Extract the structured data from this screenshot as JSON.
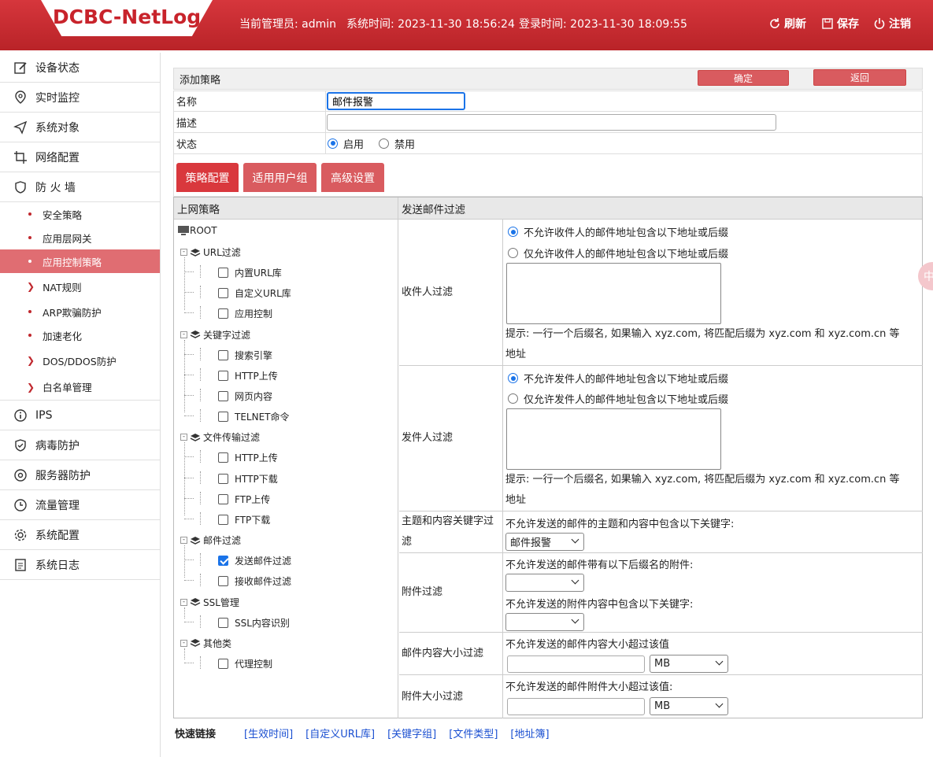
{
  "header": {
    "logo": "DCBC-NetLog",
    "admin": "当前管理员: admin",
    "system_time": "系统时间: 2023-11-30 18:56:24",
    "login_time": "登录时间: 2023-11-30 18:09:55",
    "refresh": "刷新",
    "save": "保存",
    "logout": "注销"
  },
  "sidebar": {
    "items": [
      {
        "label": "设备状态",
        "icon": "edit-icon"
      },
      {
        "label": "实时监控",
        "icon": "location-icon"
      },
      {
        "label": "系统对象",
        "icon": "send-icon"
      },
      {
        "label": "网络配置",
        "icon": "crop-icon"
      },
      {
        "label": "防 火 墙",
        "icon": "shield-icon"
      }
    ],
    "firewall_sub": [
      "安全策略",
      "应用层网关",
      "应用控制策略",
      "NAT规则",
      "ARP欺骗防护",
      "加速老化",
      "DOS/DDOS防护",
      "白名单管理"
    ],
    "bottom_items": [
      {
        "label": "IPS",
        "icon": "info-icon"
      },
      {
        "label": "病毒防护",
        "icon": "shield-check-icon"
      },
      {
        "label": "服务器防护",
        "icon": "target-icon"
      },
      {
        "label": "流量管理",
        "icon": "clock-icon"
      },
      {
        "label": "系统配置",
        "icon": "gear-icon"
      },
      {
        "label": "系统日志",
        "icon": "document-icon"
      }
    ]
  },
  "form": {
    "title": "添加策略",
    "confirm": "确定",
    "back": "返回",
    "name_label": "名称",
    "name_value": "邮件报警",
    "desc_label": "描述",
    "desc_value": "",
    "status_label": "状态",
    "enable": "启用",
    "disable": "禁用"
  },
  "tabs": [
    "策略配置",
    "适用用户组",
    "高级设置"
  ],
  "panel": {
    "left_header": "上网策略",
    "right_header": "发送邮件过滤"
  },
  "tree": {
    "root": "ROOT",
    "groups": [
      {
        "label": "URL过滤",
        "children": [
          "内置URL库",
          "自定义URL库",
          "应用控制"
        ]
      },
      {
        "label": "关键字过滤",
        "children": [
          "搜索引擎",
          "HTTP上传",
          "网页内容",
          "TELNET命令"
        ]
      },
      {
        "label": "文件传输过滤",
        "children": [
          "HTTP上传",
          "HTTP下载",
          "FTP上传",
          "FTP下载"
        ]
      },
      {
        "label": "邮件过滤",
        "children": [
          "发送邮件过滤",
          "接收邮件过滤"
        ]
      },
      {
        "label": "SSL管理",
        "children": [
          "SSL内容识别"
        ]
      },
      {
        "label": "其他类",
        "children": [
          "代理控制"
        ]
      }
    ],
    "checked": "发送邮件过滤"
  },
  "filters": {
    "recipient": {
      "label": "收件人过滤",
      "opt1": "不允许收件人的邮件地址包含以下地址或后缀",
      "opt2": "仅允许收件人的邮件地址包含以下地址或后缀",
      "hint1": "提示: 一行一个后缀名, 如果输入 xyz.com, 将匹配后缀为 xyz.com 和 xyz.com.cn 等",
      "hint2": "地址"
    },
    "sender": {
      "label": "发件人过滤",
      "opt1": "不允许发件人的邮件地址包含以下地址或后缀",
      "opt2": "仅允许发件人的邮件地址包含以下地址或后缀",
      "hint1": "提示: 一行一个后缀名, 如果输入 xyz.com, 将匹配后缀为 xyz.com 和 xyz.com.cn 等",
      "hint2": "地址"
    },
    "keyword": {
      "label1": "主题和内容关键字过",
      "label2": "滤",
      "text": "不允许发送的邮件的主题和内容中包含以下关键字:",
      "select": "邮件报警"
    },
    "attachment": {
      "label": "附件过滤",
      "text1": "不允许发送的邮件带有以下后缀名的附件:",
      "text2": "不允许发送的附件内容中包含以下关键字:"
    },
    "content_size": {
      "label": "邮件内容大小过滤",
      "text": "不允许发送的邮件内容大小超过该值",
      "unit": "MB"
    },
    "attach_size": {
      "label": "附件大小过滤",
      "text": "不允许发送的邮件附件大小超过该值:",
      "unit": "MB"
    }
  },
  "quick_links": {
    "label": "快速链接",
    "links": [
      "[生效时间]",
      "[自定义URL库]",
      "[关键字组]",
      "[文件类型]",
      "[地址簿]"
    ]
  },
  "float_badge": "中"
}
